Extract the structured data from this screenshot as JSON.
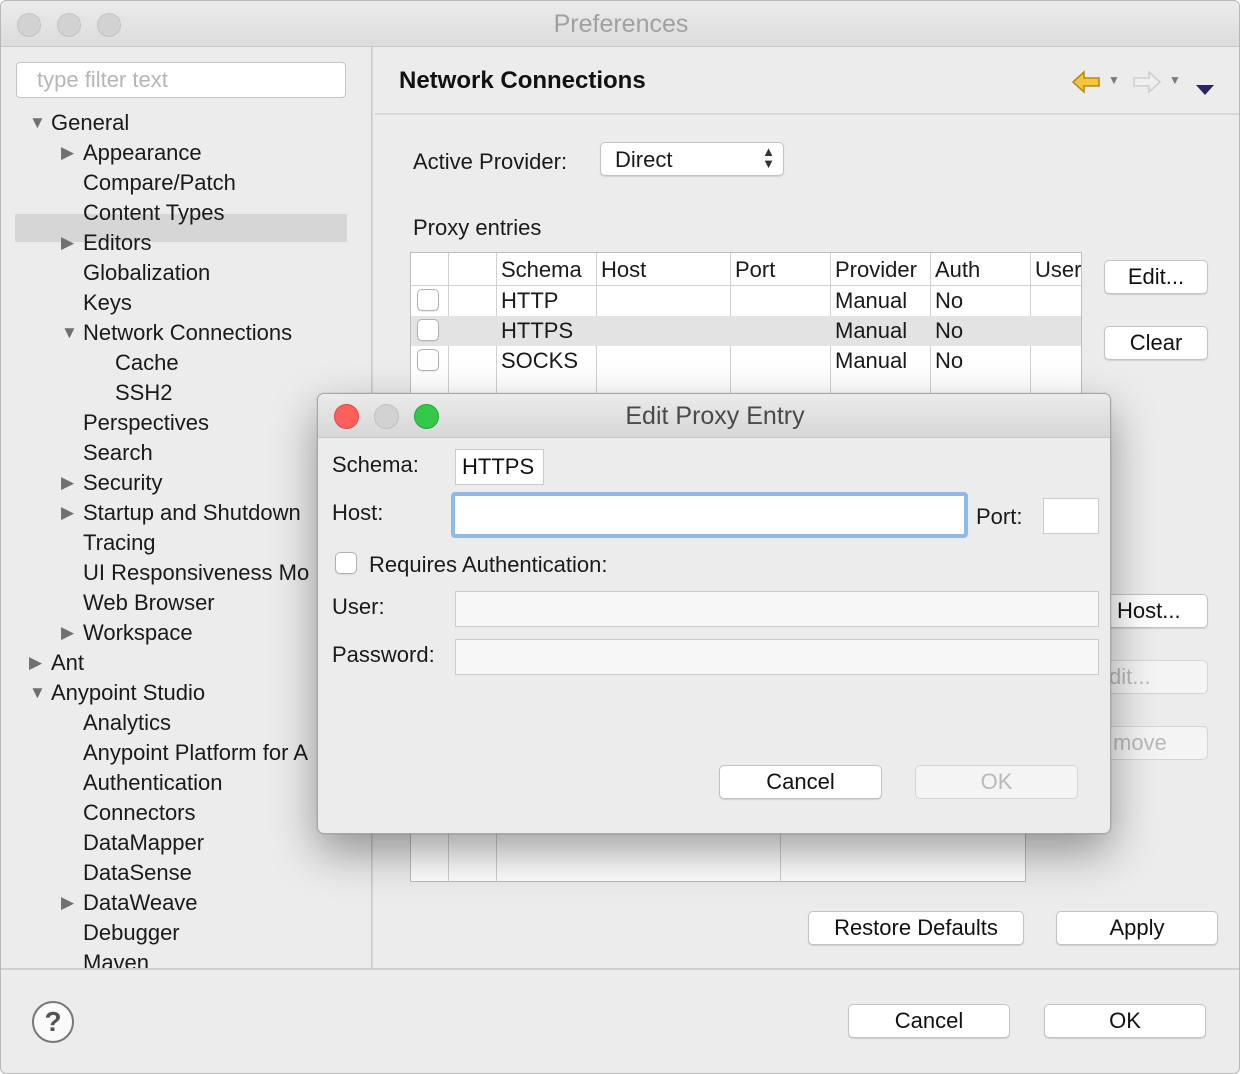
{
  "window": {
    "title": "Preferences"
  },
  "filter": {
    "placeholder": "type filter text"
  },
  "tree": {
    "items": [
      {
        "label": "General",
        "expander": "expanded"
      },
      {
        "label": "Appearance",
        "expander": "collapsed"
      },
      {
        "label": "Compare/Patch",
        "expander": "none"
      },
      {
        "label": "Content Types",
        "expander": "none"
      },
      {
        "label": "Editors",
        "expander": "collapsed"
      },
      {
        "label": "Globalization",
        "expander": "none"
      },
      {
        "label": "Keys",
        "expander": "none"
      },
      {
        "label": "Network Connections",
        "expander": "expanded",
        "selected": true
      },
      {
        "label": "Cache",
        "expander": "none"
      },
      {
        "label": "SSH2",
        "expander": "none"
      },
      {
        "label": "Perspectives",
        "expander": "none"
      },
      {
        "label": "Search",
        "expander": "none"
      },
      {
        "label": "Security",
        "expander": "collapsed"
      },
      {
        "label": "Startup and Shutdown",
        "expander": "collapsed"
      },
      {
        "label": "Tracing",
        "expander": "none"
      },
      {
        "label": "UI Responsiveness Mo",
        "expander": "none"
      },
      {
        "label": "Web Browser",
        "expander": "none"
      },
      {
        "label": "Workspace",
        "expander": "collapsed"
      },
      {
        "label": "Ant",
        "expander": "collapsed"
      },
      {
        "label": "Anypoint Studio",
        "expander": "expanded"
      },
      {
        "label": "Analytics",
        "expander": "none"
      },
      {
        "label": "Anypoint Platform for A",
        "expander": "none"
      },
      {
        "label": "Authentication",
        "expander": "none"
      },
      {
        "label": "Connectors",
        "expander": "none"
      },
      {
        "label": "DataMapper",
        "expander": "none"
      },
      {
        "label": "DataSense",
        "expander": "none"
      },
      {
        "label": "DataWeave",
        "expander": "collapsed"
      },
      {
        "label": "Debugger",
        "expander": "none"
      },
      {
        "label": "Maven",
        "expander": "none"
      }
    ]
  },
  "page": {
    "title": "Network Connections",
    "active_provider_label": "Active Provider:",
    "active_provider_value": "Direct",
    "proxy_entries_label": "Proxy entries",
    "columns": [
      "Schema",
      "Host",
      "Port",
      "Provider",
      "Auth",
      "User"
    ],
    "rows": [
      {
        "schema": "HTTP",
        "host": "",
        "port": "",
        "provider": "Manual",
        "auth": "No",
        "user": ""
      },
      {
        "schema": "HTTPS",
        "host": "",
        "port": "",
        "provider": "Manual",
        "auth": "No",
        "user": ""
      },
      {
        "schema": "SOCKS",
        "host": "",
        "port": "",
        "provider": "Manual",
        "auth": "No",
        "user": ""
      }
    ],
    "edit_button": "Edit...",
    "clear_button": "Clear",
    "host_button": "Host...",
    "edit2_button": "dit...",
    "remove_button": "move",
    "restore_defaults": "Restore Defaults",
    "apply": "Apply"
  },
  "footer": {
    "cancel": "Cancel",
    "ok": "OK",
    "help": "?"
  },
  "dialog": {
    "title": "Edit Proxy Entry",
    "schema_label": "Schema:",
    "schema_value": "HTTPS",
    "host_label": "Host:",
    "host_value": "",
    "port_label": "Port:",
    "port_value": "",
    "requires_auth_label": "Requires Authentication:",
    "user_label": "User:",
    "user_value": "",
    "password_label": "Password:",
    "password_value": "",
    "cancel": "Cancel",
    "ok": "OK"
  },
  "colors": {
    "selection": "#d6d6d6",
    "focus_ring": "#8fb9ea",
    "traffic_red": "#fc605c",
    "traffic_yellow": "#fdbc40",
    "traffic_green": "#34c84a",
    "nav_back": "#f5c542"
  },
  "icons": {
    "back": "back-arrow-icon",
    "forward": "forward-arrow-icon",
    "menu": "view-menu-icon",
    "help": "help-icon"
  }
}
